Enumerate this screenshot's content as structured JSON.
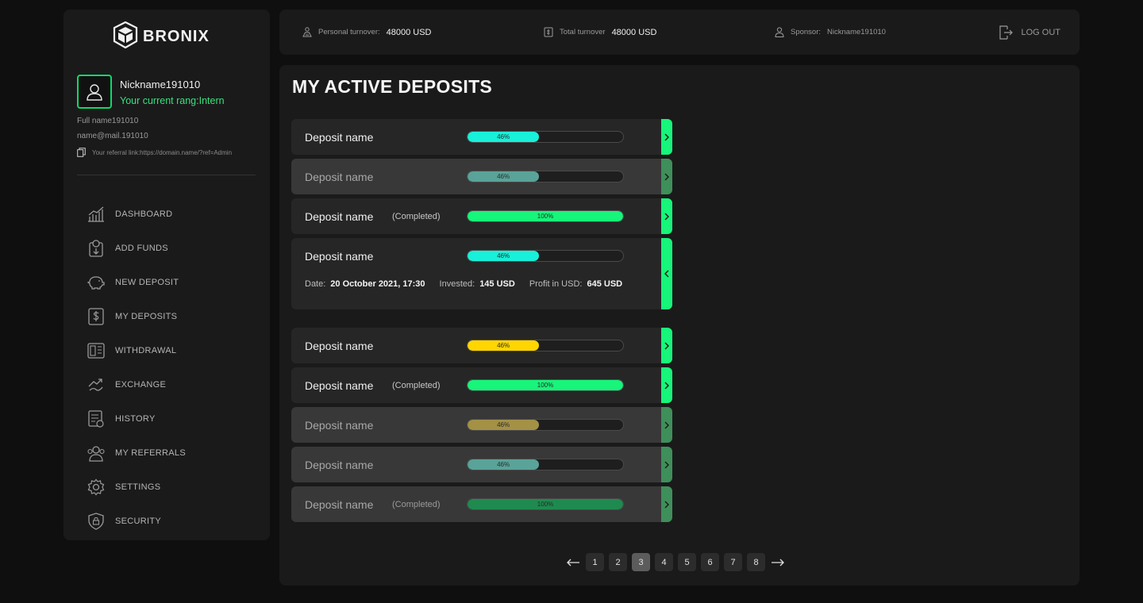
{
  "brand": {
    "name": "BRONIX"
  },
  "profile": {
    "nickname": "Nickname191010",
    "rang": "Your current rang:Intern",
    "full_name": "Full name191010",
    "email": "name@mail.191010",
    "referral": "Your referral link:https://domain.name/?ref=Admin"
  },
  "nav": [
    {
      "label": "DASHBOARD",
      "icon": "chart-icon"
    },
    {
      "label": "ADD FUNDS",
      "icon": "add-funds-icon"
    },
    {
      "label": "NEW DEPOSIT",
      "icon": "piggy-bank-icon"
    },
    {
      "label": "MY DEPOSITS",
      "icon": "dollar-icon"
    },
    {
      "label": "WITHDRAWAL",
      "icon": "wallet-icon"
    },
    {
      "label": "EXCHANGE",
      "icon": "exchange-icon"
    },
    {
      "label": "HISTORY",
      "icon": "history-icon"
    },
    {
      "label": "MY REFERRALS",
      "icon": "referrals-icon"
    },
    {
      "label": "SETTINGS",
      "icon": "gear-icon"
    },
    {
      "label": "SECURITY",
      "icon": "shield-icon"
    }
  ],
  "topbar": {
    "personal_label": "Personal turnover:",
    "personal_value": "48000 USD",
    "total_label": "Total turnover",
    "total_value": "48000 USD",
    "sponsor_label": "Sponsor:",
    "sponsor_value": "Nickname191010",
    "logout": "LOG OUT"
  },
  "main": {
    "title": "MY ACTIVE DEPOSITS",
    "details": {
      "date_label": "Date:",
      "date_value": "20 October 2021, 17:30",
      "invested_label": "Invested:",
      "invested_value": "145 USD",
      "profit_label": "Profit in USD:",
      "profit_value": "645 USD"
    },
    "deposits": [
      {
        "name": "Deposit name",
        "status": "",
        "progress": 0.46,
        "progress_label": "46%",
        "fill": "#19f0d9",
        "dim": false,
        "expanded": false
      },
      {
        "name": "Deposit name",
        "status": "",
        "progress": 0.46,
        "progress_label": "46%",
        "fill": "#5aa399",
        "dim": true,
        "expanded": false
      },
      {
        "name": "Deposit name",
        "status": "(Completed)",
        "progress": 1.0,
        "progress_label": "100%",
        "fill": "#17f57a",
        "dim": false,
        "expanded": false
      },
      {
        "name": "Deposit name",
        "status": "",
        "progress": 0.46,
        "progress_label": "46%",
        "fill": "#19f0d9",
        "dim": false,
        "expanded": true
      },
      {
        "name": "Deposit name",
        "status": "",
        "progress": 0.46,
        "progress_label": "46%",
        "fill": "#ffd600",
        "dim": false,
        "expanded": false
      },
      {
        "name": "Deposit name",
        "status": "(Completed)",
        "progress": 1.0,
        "progress_label": "100%",
        "fill": "#17f57a",
        "dim": false,
        "expanded": false
      },
      {
        "name": "Deposit name",
        "status": "",
        "progress": 0.46,
        "progress_label": "46%",
        "fill": "#a39146",
        "dim": true,
        "expanded": false
      },
      {
        "name": "Deposit name",
        "status": "",
        "progress": 0.46,
        "progress_label": "46%",
        "fill": "#5aa399",
        "dim": true,
        "expanded": false
      },
      {
        "name": "Deposit name",
        "status": "(Completed)",
        "progress": 1.0,
        "progress_label": "100%",
        "fill": "#1f8a4f",
        "dim": true,
        "expanded": false
      }
    ]
  },
  "pagination": {
    "pages": [
      "1",
      "2",
      "3",
      "4",
      "5",
      "6",
      "7",
      "8"
    ],
    "current": "3"
  },
  "colors": {
    "accent": "#17f57a",
    "tab_dim": "#3f8f5a",
    "bg": "#0f0f0f",
    "panel": "#1a1a1a"
  }
}
